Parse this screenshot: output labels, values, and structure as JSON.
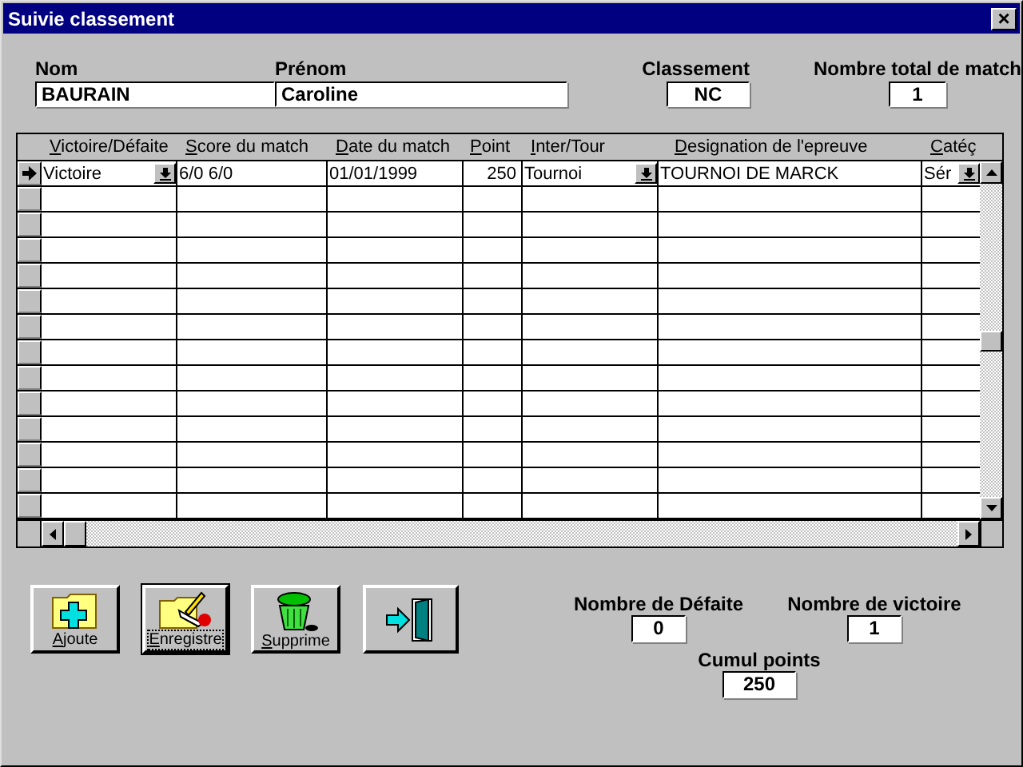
{
  "window": {
    "title": "Suivie classement",
    "close": "×"
  },
  "header_fields": [
    {
      "label": "Nom",
      "value": "BAURAIN",
      "kind": "wide"
    },
    {
      "label": "Prénom",
      "value": "Caroline",
      "kind": "wide"
    },
    {
      "label": "Classement",
      "value": "NC",
      "kind": "short"
    },
    {
      "label": "Nombre total de match",
      "value": "1",
      "kind": "short"
    }
  ],
  "table": {
    "columns": [
      "Victoire/Défaite",
      "Score du match",
      "Date du match",
      "Point",
      "Inter/Tour",
      "Designation de l'epreuve",
      "Catéç"
    ],
    "rows": [
      {
        "selected": true,
        "cells": [
          {
            "text": "Victoire",
            "kind": "combo"
          },
          {
            "text": "6/0 6/0",
            "kind": "text"
          },
          {
            "text": "01/01/1999",
            "kind": "text"
          },
          {
            "text": "250",
            "kind": "number"
          },
          {
            "text": "Tournoi",
            "kind": "combo"
          },
          {
            "text": "TOURNOI DE MARCK",
            "kind": "text"
          },
          {
            "text": "Sér",
            "kind": "combo"
          }
        ]
      }
    ]
  },
  "buttons": [
    {
      "label": "Ajoute",
      "kind": "add",
      "focused": false
    },
    {
      "label": "Enregistre",
      "kind": "save",
      "focused": true
    },
    {
      "label": "Supprime",
      "kind": "delete",
      "focused": false
    },
    {
      "kind": "exit",
      "focused": false
    }
  ],
  "totals": [
    {
      "label": "Nombre de Défaite",
      "value": "0"
    },
    {
      "label": "Nombre de victoire",
      "value": "1"
    },
    {
      "label": "Cumul points",
      "value": "250"
    }
  ]
}
